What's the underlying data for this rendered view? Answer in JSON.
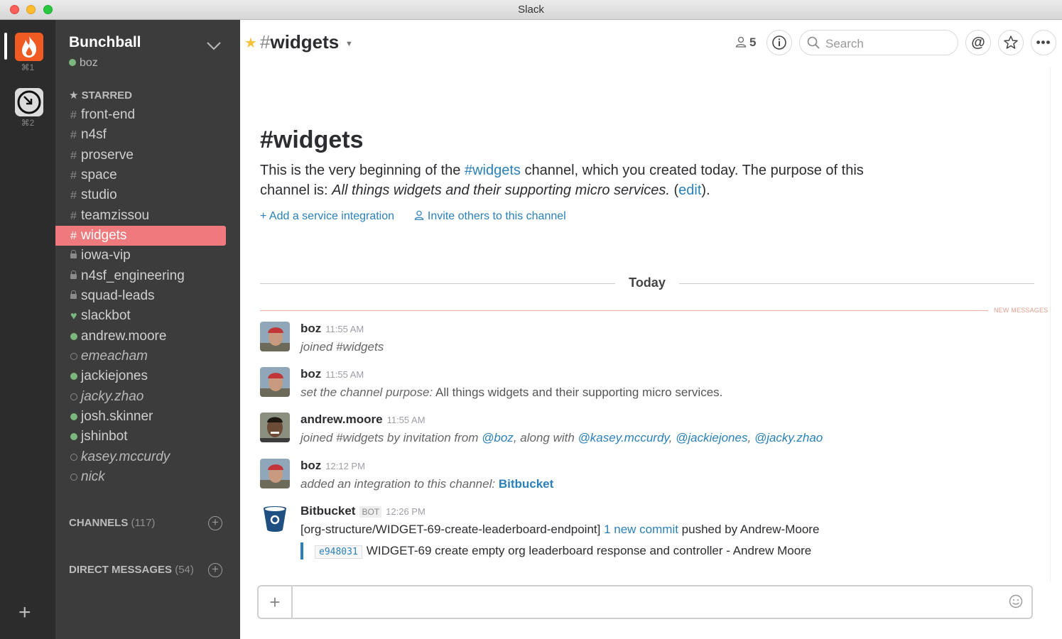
{
  "window": {
    "title": "Slack"
  },
  "teams": [
    {
      "key": "⌘1"
    },
    {
      "key": "⌘2"
    }
  ],
  "sidebar": {
    "team_name": "Bunchball",
    "user": "boz",
    "starred_label": "STARRED",
    "channels_label": "CHANNELS",
    "channels_count": "(117)",
    "dm_label": "DIRECT MESSAGES",
    "dm_count": "(54)",
    "items": [
      {
        "label": "front-end",
        "kind": "channel"
      },
      {
        "label": "n4sf",
        "kind": "channel"
      },
      {
        "label": "proserve",
        "kind": "channel"
      },
      {
        "label": "space",
        "kind": "channel"
      },
      {
        "label": "studio",
        "kind": "channel"
      },
      {
        "label": "teamzissou",
        "kind": "channel"
      },
      {
        "label": "widgets",
        "kind": "channel",
        "active": true
      },
      {
        "label": "iowa-vip",
        "kind": "private"
      },
      {
        "label": "n4sf_engineering",
        "kind": "private"
      },
      {
        "label": "squad-leads",
        "kind": "private"
      },
      {
        "label": "slackbot",
        "kind": "bot"
      },
      {
        "label": "andrew.moore",
        "kind": "online"
      },
      {
        "label": "emeacham",
        "kind": "away"
      },
      {
        "label": "jackiejones",
        "kind": "online"
      },
      {
        "label": "jacky.zhao",
        "kind": "away"
      },
      {
        "label": "josh.skinner",
        "kind": "online"
      },
      {
        "label": "jshinbot",
        "kind": "online"
      },
      {
        "label": "kasey.mccurdy",
        "kind": "away"
      },
      {
        "label": "nick",
        "kind": "away"
      }
    ]
  },
  "header": {
    "channel_name": "widgets",
    "member_count": "5",
    "search_placeholder": "Search"
  },
  "intro": {
    "title": "#widgets",
    "text_1": "This is the very beginning of the ",
    "channel_link": "#widgets",
    "text_2": " channel, which you created today. The purpose of this channel is: ",
    "purpose": "All things widgets and their supporting micro services.",
    "text_3": " (",
    "edit_link": "edit",
    "text_4": ").",
    "add_integration": "Add a service integration",
    "invite_others": "Invite others to this channel"
  },
  "day_divider": "Today",
  "new_messages_label": "NEW MESSAGES",
  "messages": [
    {
      "author": "boz",
      "time": "11:55 AM",
      "text": "joined #widgets"
    },
    {
      "author": "boz",
      "time": "11:55 AM",
      "text_em": "set the channel purpose:",
      "text": "All things widgets and their supporting micro services."
    },
    {
      "author": "andrew.moore",
      "time": "11:55 AM",
      "text_1": "joined #widgets by invitation from ",
      "mention_1": "@boz",
      "text_2": ", along with ",
      "mention_2": "@kasey.mccurdy",
      "sep_1": ", ",
      "mention_3": "@jackiejones",
      "sep_2": ", ",
      "mention_4": "@jacky.zhao"
    },
    {
      "author": "boz",
      "time": "12:12 PM",
      "text": "added an integration to this channel: ",
      "link": "Bitbucket"
    },
    {
      "author": "Bitbucket",
      "badge": "BOT",
      "time": "12:26 PM",
      "text_1": "[org-structure/WIDGET-69-create-leaderboard-endpoint] ",
      "link": "1 new commit",
      "text_2": " pushed by Andrew-Moore",
      "commit_hash": "e948031",
      "commit_msg": "WIDGET-69 create empty org leaderboard response and controller - Andrew Moore"
    }
  ],
  "colors": {
    "active_channel": "#ef7a7d",
    "link": "#2a80b9",
    "online": "#7ab77d",
    "star": "#f5c33b"
  }
}
